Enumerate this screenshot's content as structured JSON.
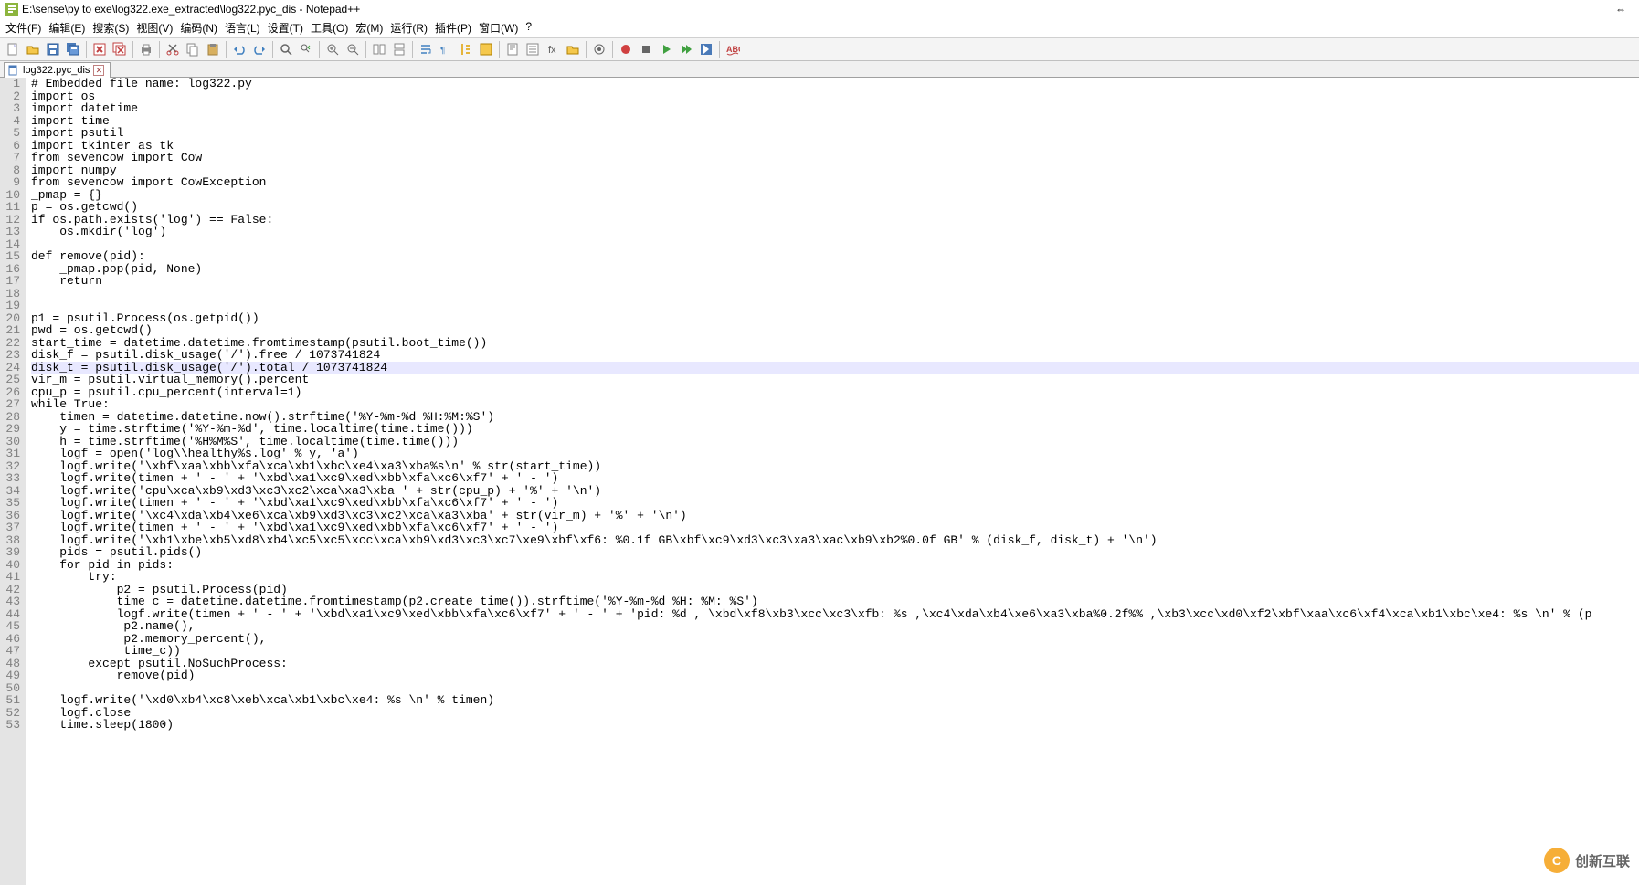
{
  "window": {
    "title": "E:\\sense\\py to exe\\log322.exe_extracted\\log322.pyc_dis - Notepad++"
  },
  "menu": {
    "file": "文件(F)",
    "edit": "编辑(E)",
    "search": "搜索(S)",
    "view": "视图(V)",
    "encoding": "编码(N)",
    "language": "语言(L)",
    "settings": "设置(T)",
    "tools": "工具(O)",
    "macro": "宏(M)",
    "run": "运行(R)",
    "plugins": "插件(P)",
    "window": "窗口(W)",
    "help": "?"
  },
  "tab": {
    "label": "log322.pyc_dis"
  },
  "code": [
    "# Embedded file name: log322.py",
    "import os",
    "import datetime",
    "import time",
    "import psutil",
    "import tkinter as tk",
    "from sevencow import Cow",
    "import numpy",
    "from sevencow import CowException",
    "_pmap = {}",
    "p = os.getcwd()",
    "if os.path.exists('log') == False:",
    "    os.mkdir('log')",
    "",
    "def remove(pid):",
    "    _pmap.pop(pid, None)",
    "    return",
    "",
    "",
    "p1 = psutil.Process(os.getpid())",
    "pwd = os.getcwd()",
    "start_time = datetime.datetime.fromtimestamp(psutil.boot_time())",
    "disk_f = psutil.disk_usage('/').free / 1073741824",
    "disk_t = psutil.disk_usage('/').total / 1073741824",
    "vir_m = psutil.virtual_memory().percent",
    "cpu_p = psutil.cpu_percent(interval=1)",
    "while True:",
    "    timen = datetime.datetime.now().strftime('%Y-%m-%d %H:%M:%S')",
    "    y = time.strftime('%Y-%m-%d', time.localtime(time.time()))",
    "    h = time.strftime('%H%M%S', time.localtime(time.time()))",
    "    logf = open('log\\\\healthy%s.log' % y, 'a')",
    "    logf.write('\\xbf\\xaa\\xbb\\xfa\\xca\\xb1\\xbc\\xe4\\xa3\\xba%s\\n' % str(start_time))",
    "    logf.write(timen + ' - ' + '\\xbd\\xa1\\xc9\\xed\\xbb\\xfa\\xc6\\xf7' + ' - ')",
    "    logf.write('cpu\\xca\\xb9\\xd3\\xc3\\xc2\\xca\\xa3\\xba ' + str(cpu_p) + '%' + '\\n')",
    "    logf.write(timen + ' - ' + '\\xbd\\xa1\\xc9\\xed\\xbb\\xfa\\xc6\\xf7' + ' - ')",
    "    logf.write('\\xc4\\xda\\xb4\\xe6\\xca\\xb9\\xd3\\xc3\\xc2\\xca\\xa3\\xba' + str(vir_m) + '%' + '\\n')",
    "    logf.write(timen + ' - ' + '\\xbd\\xa1\\xc9\\xed\\xbb\\xfa\\xc6\\xf7' + ' - ')",
    "    logf.write('\\xb1\\xbe\\xb5\\xd8\\xb4\\xc5\\xc5\\xcc\\xca\\xb9\\xd3\\xc3\\xc7\\xe9\\xbf\\xf6: %0.1f GB\\xbf\\xc9\\xd3\\xc3\\xa3\\xac\\xb9\\xb2%0.0f GB' % (disk_f, disk_t) + '\\n')",
    "    pids = psutil.pids()",
    "    for pid in pids:",
    "        try:",
    "            p2 = psutil.Process(pid)",
    "            time_c = datetime.datetime.fromtimestamp(p2.create_time()).strftime('%Y-%m-%d %H: %M: %S')",
    "            logf.write(timen + ' - ' + '\\xbd\\xa1\\xc9\\xed\\xbb\\xfa\\xc6\\xf7' + ' - ' + 'pid: %d , \\xbd\\xf8\\xb3\\xcc\\xc3\\xfb: %s ,\\xc4\\xda\\xb4\\xe6\\xa3\\xba%0.2f%% ,\\xb3\\xcc\\xd0\\xf2\\xbf\\xaa\\xc6\\xf4\\xca\\xb1\\xbc\\xe4: %s \\n' % (p",
    "             p2.name(),",
    "             p2.memory_percent(),",
    "             time_c))",
    "        except psutil.NoSuchProcess:",
    "            remove(pid)",
    "",
    "    logf.write('\\xd0\\xb4\\xc8\\xeb\\xca\\xb1\\xbc\\xe4: %s \\n' % timen)",
    "    logf.close",
    "    time.sleep(1800)"
  ],
  "highlight_line": 24,
  "watermark": {
    "text": "创新互联"
  }
}
